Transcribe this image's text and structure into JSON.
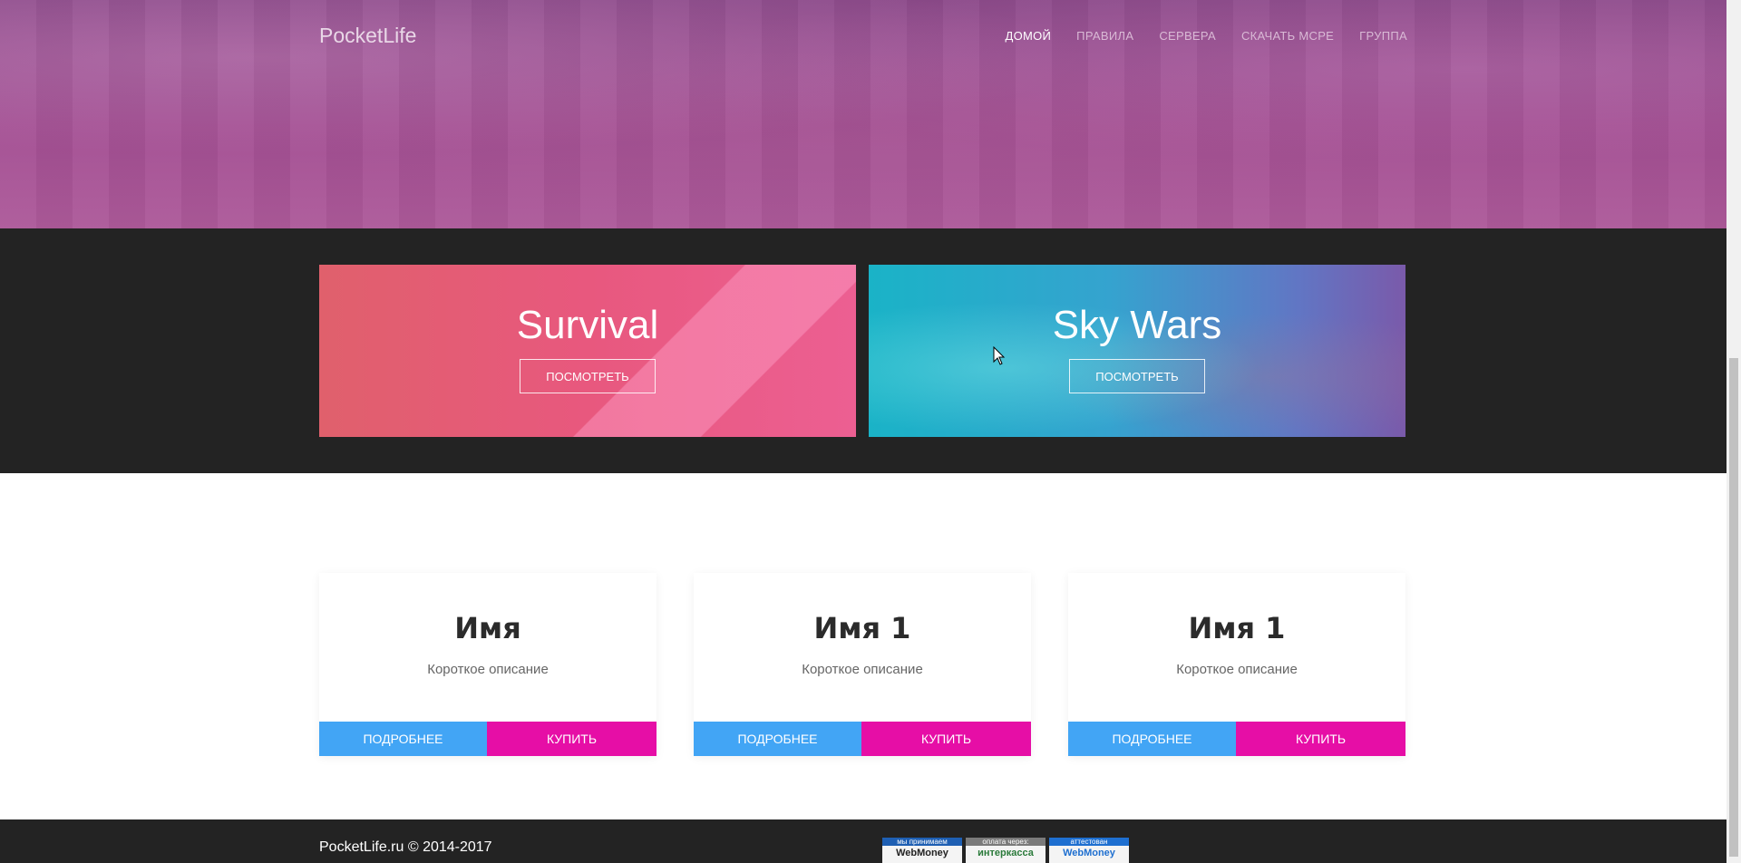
{
  "header": {
    "brand": "PocketLife",
    "nav": [
      {
        "label": "ДОМОЙ",
        "active": true
      },
      {
        "label": "ПРАВИЛА",
        "active": false
      },
      {
        "label": "СЕРВЕРА",
        "active": false
      },
      {
        "label": "СКАЧАТЬ MCPE",
        "active": false
      },
      {
        "label": "ГРУППА",
        "active": false
      }
    ]
  },
  "servers": [
    {
      "title": "Survival",
      "button": "ПОСМОТРЕТЬ"
    },
    {
      "title": "Sky Wars",
      "button": "ПОСМОТРЕТЬ"
    }
  ],
  "products": [
    {
      "name": "Имя",
      "description": "Короткое описание",
      "more_label": "ПОДРОБНЕЕ",
      "buy_label": "КУПИТЬ"
    },
    {
      "name": "Имя 1",
      "description": "Короткое описание",
      "more_label": "ПОДРОБНЕЕ",
      "buy_label": "КУПИТЬ"
    },
    {
      "name": "Имя 1",
      "description": "Короткое описание",
      "more_label": "ПОДРОБНЕЕ",
      "buy_label": "КУПИТЬ"
    }
  ],
  "footer": {
    "copyright": "PocketLife.ru © 2014-2017",
    "badges": [
      {
        "top": "мы принимаем",
        "bottom": "WebMoney",
        "icon": "webmoney-icon"
      },
      {
        "top": "оплата через:",
        "bottom": "интеркасса",
        "icon": "interkassa-icon"
      },
      {
        "top": "аттестован",
        "bottom": "WebMoney",
        "icon": "webmoney-attest-icon"
      }
    ]
  },
  "colors": {
    "more_button": "#42a5f5",
    "buy_button": "#e60ea6",
    "dark_band": "#232323"
  }
}
